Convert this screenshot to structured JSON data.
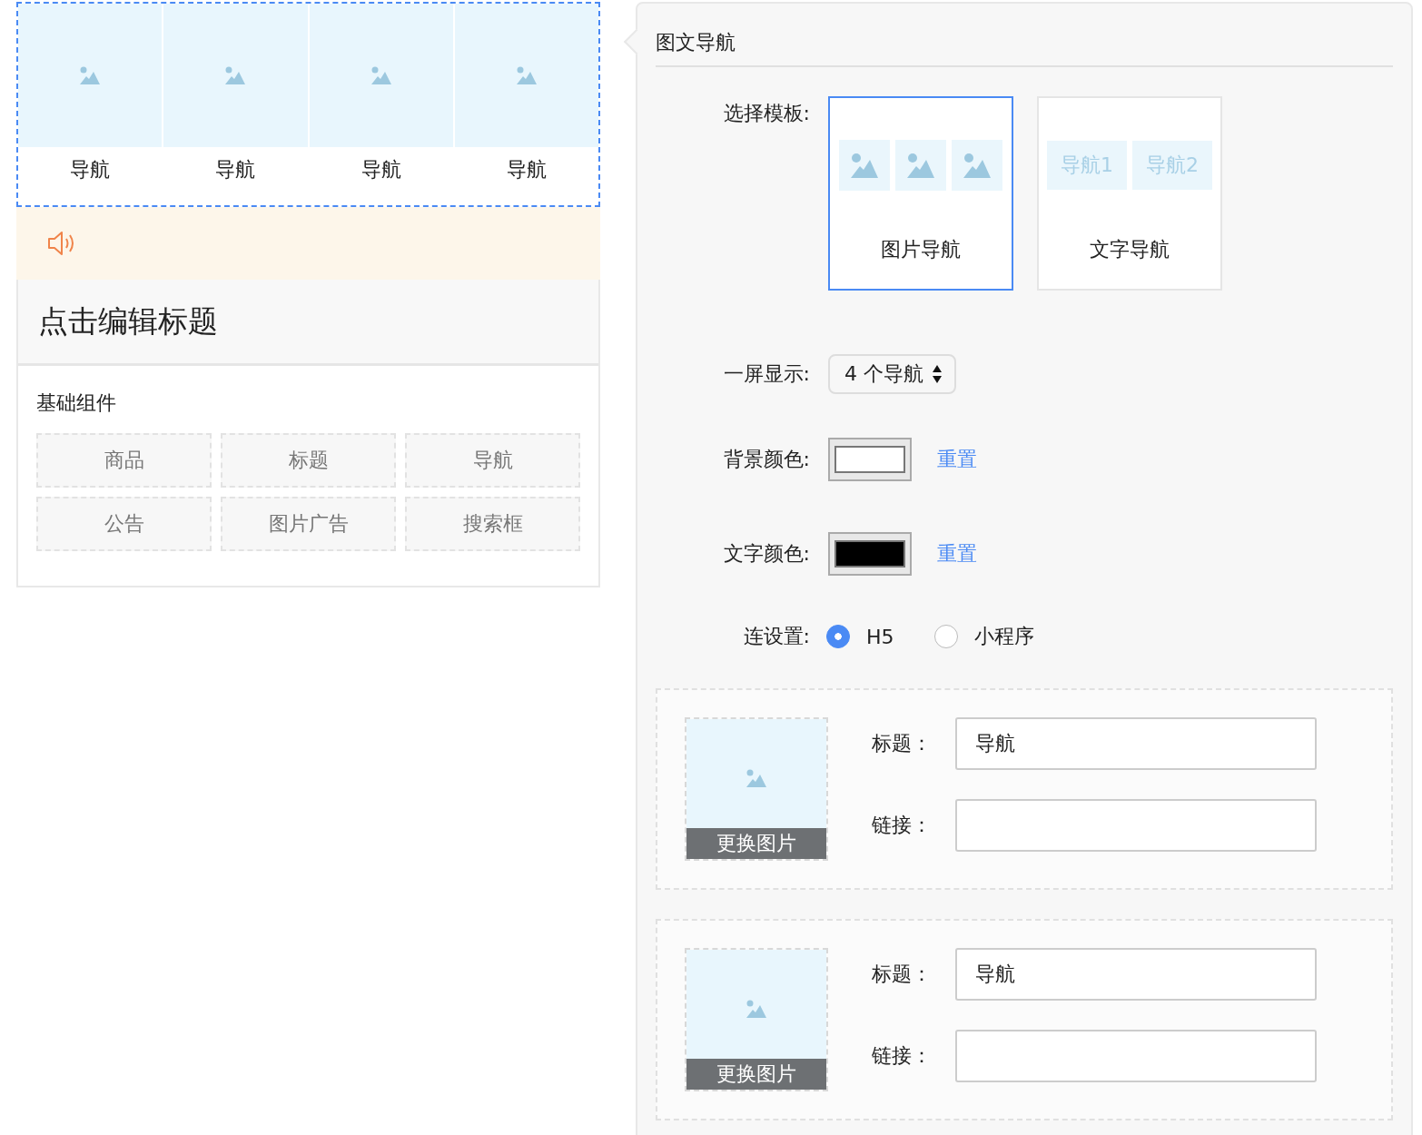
{
  "preview": {
    "nav_items": [
      {
        "label": "导航"
      },
      {
        "label": "导航"
      },
      {
        "label": "导航"
      },
      {
        "label": "导航"
      }
    ],
    "title": "点击编辑标题",
    "components": {
      "heading": "基础组件",
      "items": [
        "商品",
        "标题",
        "导航",
        "公告",
        "图片广告",
        "搜索框"
      ]
    }
  },
  "editor": {
    "title": "图文导航",
    "template": {
      "label": "选择模板:",
      "options": [
        {
          "kind": "image",
          "label": "图片导航",
          "selected": true
        },
        {
          "kind": "text",
          "label": "文字导航",
          "selected": false,
          "samples": [
            "导航1",
            "导航2"
          ]
        }
      ]
    },
    "per_screen": {
      "label": "一屏显示:",
      "value": "4 个导航"
    },
    "colors": [
      {
        "label": "背景颜色:",
        "color": "#ffffff",
        "reset": "重置"
      },
      {
        "label": "文字颜色:",
        "color": "#000000",
        "reset": "重置"
      }
    ],
    "link_mode": {
      "label": "连设置:",
      "options": [
        {
          "label": "H5",
          "selected": true
        },
        {
          "label": "小程序",
          "selected": false
        }
      ]
    },
    "items": [
      {
        "change_image": "更换图片",
        "title_label": "标题：",
        "title_value": "导航",
        "link_label": "链接："
      },
      {
        "change_image": "更换图片",
        "title_label": "标题：",
        "title_value": "导航",
        "link_label": "链接："
      }
    ]
  }
}
